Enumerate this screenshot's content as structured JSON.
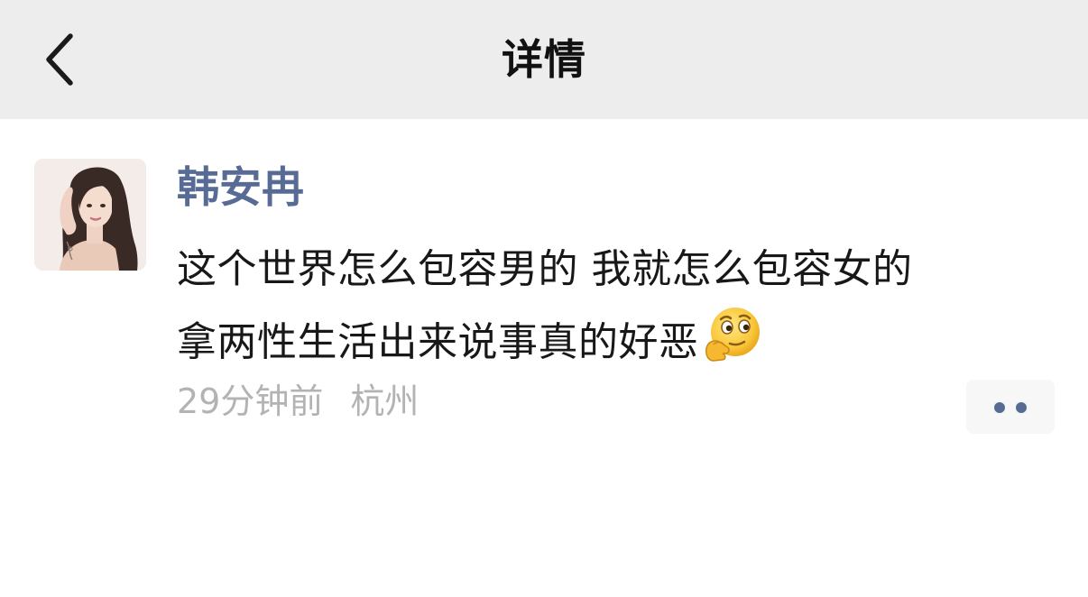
{
  "header": {
    "title": "详情",
    "background": "#ededed",
    "back_icon": "chevron-left-icon"
  },
  "post": {
    "author": "韩安冉",
    "author_color": "#576b95",
    "content_lines": [
      "这个世界怎么包容男的 我就怎么包容女的",
      "拿两性生活出来说事真的好恶"
    ],
    "emoji": "thinking-face-emoji",
    "time": "29分钟前",
    "location": "杭州",
    "more_icon": "more-dots-icon"
  }
}
